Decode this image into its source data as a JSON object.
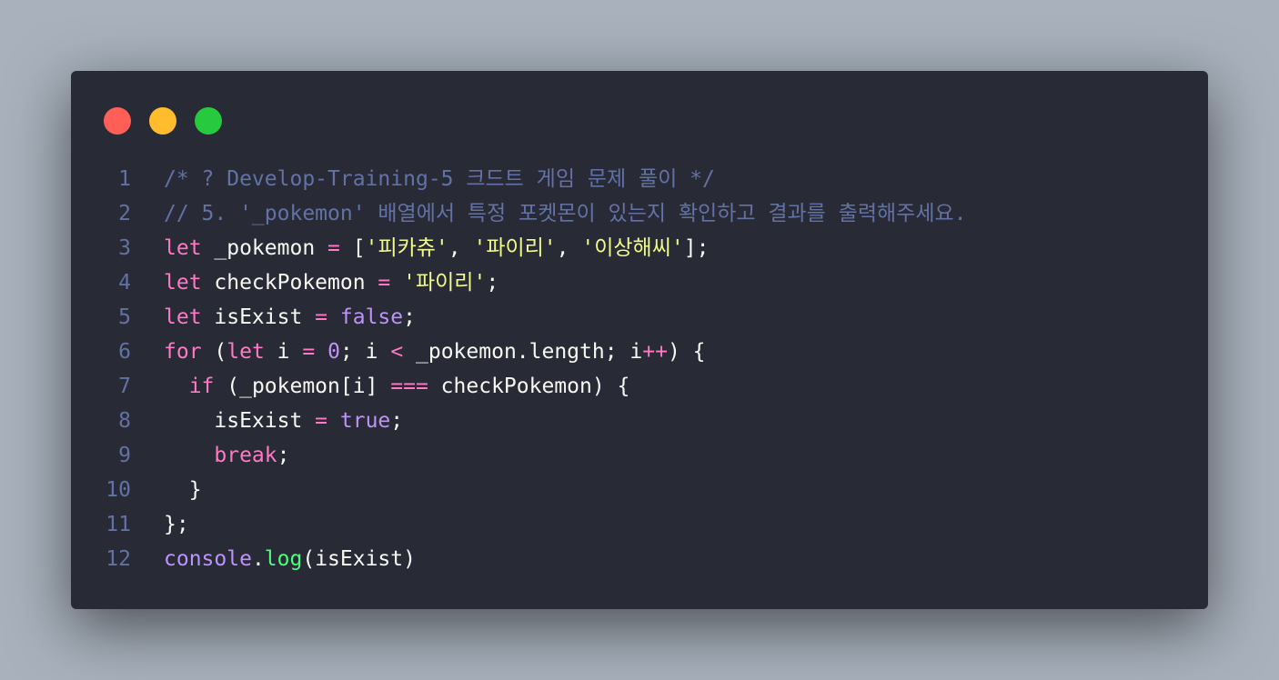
{
  "window": {
    "controls": [
      {
        "name": "close-dot",
        "color": "#ff5f56"
      },
      {
        "name": "minimize-dot",
        "color": "#ffbd2e"
      },
      {
        "name": "maximize-dot",
        "color": "#27c93f"
      }
    ]
  },
  "code": {
    "lines": [
      {
        "number": "1",
        "tokens": [
          {
            "t": "comment",
            "v": "/* ? Develop-Training-5 크드트 게임 문제 풀이 */"
          }
        ]
      },
      {
        "number": "2",
        "tokens": [
          {
            "t": "comment",
            "v": "// 5. '_pokemon' 배열에서 특정 포켓몬이 있는지 확인하고 결과를 출력해주세요."
          }
        ]
      },
      {
        "number": "3",
        "tokens": [
          {
            "t": "keyword",
            "v": "let"
          },
          {
            "t": "plain",
            "v": " _pokemon "
          },
          {
            "t": "op",
            "v": "="
          },
          {
            "t": "plain",
            "v": " ["
          },
          {
            "t": "string",
            "v": "'피카츄'"
          },
          {
            "t": "plain",
            "v": ", "
          },
          {
            "t": "string",
            "v": "'파이리'"
          },
          {
            "t": "plain",
            "v": ", "
          },
          {
            "t": "string",
            "v": "'이상해씨'"
          },
          {
            "t": "plain",
            "v": "];"
          }
        ]
      },
      {
        "number": "4",
        "tokens": [
          {
            "t": "keyword",
            "v": "let"
          },
          {
            "t": "plain",
            "v": " checkPokemon "
          },
          {
            "t": "op",
            "v": "="
          },
          {
            "t": "plain",
            "v": " "
          },
          {
            "t": "string",
            "v": "'파이리'"
          },
          {
            "t": "plain",
            "v": ";"
          }
        ]
      },
      {
        "number": "5",
        "tokens": [
          {
            "t": "keyword",
            "v": "let"
          },
          {
            "t": "plain",
            "v": " isExist "
          },
          {
            "t": "op",
            "v": "="
          },
          {
            "t": "plain",
            "v": " "
          },
          {
            "t": "const",
            "v": "false"
          },
          {
            "t": "plain",
            "v": ";"
          }
        ]
      },
      {
        "number": "6",
        "tokens": [
          {
            "t": "keyword",
            "v": "for"
          },
          {
            "t": "plain",
            "v": " ("
          },
          {
            "t": "keyword",
            "v": "let"
          },
          {
            "t": "plain",
            "v": " i "
          },
          {
            "t": "op",
            "v": "="
          },
          {
            "t": "plain",
            "v": " "
          },
          {
            "t": "const",
            "v": "0"
          },
          {
            "t": "plain",
            "v": "; i "
          },
          {
            "t": "op",
            "v": "<"
          },
          {
            "t": "plain",
            "v": " _pokemon.length; i"
          },
          {
            "t": "op",
            "v": "++"
          },
          {
            "t": "plain",
            "v": ") {"
          }
        ]
      },
      {
        "number": "7",
        "tokens": [
          {
            "t": "plain",
            "v": "  "
          },
          {
            "t": "keyword",
            "v": "if"
          },
          {
            "t": "plain",
            "v": " (_pokemon[i] "
          },
          {
            "t": "op",
            "v": "==="
          },
          {
            "t": "plain",
            "v": " checkPokemon) {"
          }
        ]
      },
      {
        "number": "8",
        "tokens": [
          {
            "t": "plain",
            "v": "    isExist "
          },
          {
            "t": "op",
            "v": "="
          },
          {
            "t": "plain",
            "v": " "
          },
          {
            "t": "const",
            "v": "true"
          },
          {
            "t": "plain",
            "v": ";"
          }
        ]
      },
      {
        "number": "9",
        "tokens": [
          {
            "t": "plain",
            "v": "    "
          },
          {
            "t": "keyword",
            "v": "break"
          },
          {
            "t": "plain",
            "v": ";"
          }
        ]
      },
      {
        "number": "10",
        "tokens": [
          {
            "t": "plain",
            "v": "  }"
          }
        ]
      },
      {
        "number": "11",
        "tokens": [
          {
            "t": "plain",
            "v": "};"
          }
        ]
      },
      {
        "number": "12",
        "tokens": [
          {
            "t": "builtin",
            "v": "console"
          },
          {
            "t": "plain",
            "v": "."
          },
          {
            "t": "func",
            "v": "log"
          },
          {
            "t": "plain",
            "v": "(isExist)"
          }
        ]
      }
    ]
  }
}
